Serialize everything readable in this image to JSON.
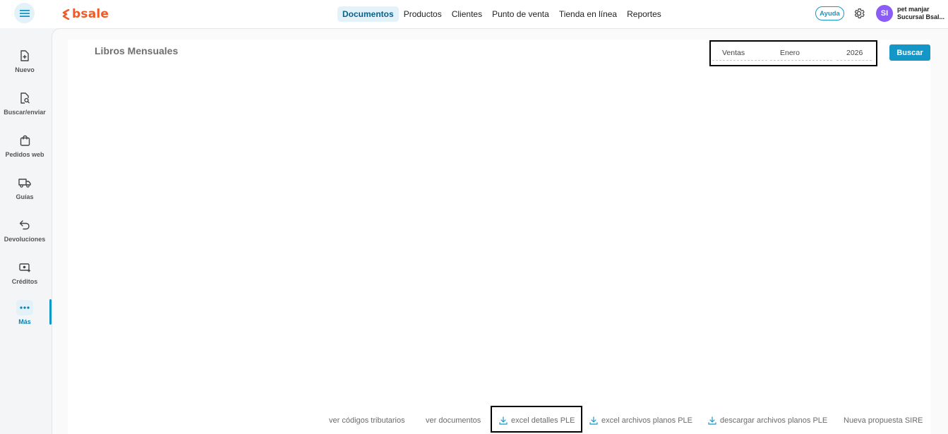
{
  "header": {
    "logo_text": "bsale",
    "nav": [
      "Documentos",
      "Productos",
      "Clientes",
      "Punto de venta",
      "Tienda en línea",
      "Reportes"
    ],
    "active_nav": "Documentos",
    "help_label": "Ayuda",
    "avatar_initials": "SI",
    "user_name": "pet manjar",
    "user_branch": "Sucursal Bsal..."
  },
  "sidebar": {
    "items": [
      {
        "label": "Nuevo",
        "icon": "file-plus-icon"
      },
      {
        "label": "Buscar/enviar",
        "icon": "file-search-icon"
      },
      {
        "label": "Pedidos web",
        "icon": "shopping-bag-icon"
      },
      {
        "label": "Guías",
        "icon": "truck-icon"
      },
      {
        "label": "Devoluciones",
        "icon": "return-arrow-icon"
      },
      {
        "label": "Créditos",
        "icon": "credit-icon"
      },
      {
        "label": "Más",
        "icon": "more-dots-icon"
      }
    ],
    "active": "Más"
  },
  "page": {
    "title": "Libros Mensuales",
    "filters": {
      "tipo": "Ventas",
      "mes": "Enero",
      "anio": "2026"
    },
    "search_button": "Buscar"
  },
  "footer": {
    "links": [
      {
        "label": "ver códigos tributarios",
        "icon": ""
      },
      {
        "label": "ver documentos",
        "icon": ""
      },
      {
        "label": "excel detalles PLE",
        "icon": "download-icon"
      },
      {
        "label": "excel archivos planos PLE",
        "icon": "download-icon"
      },
      {
        "label": "descargar archivos planos PLE",
        "icon": "download-icon"
      },
      {
        "label": "Nueva propuesta SIRE",
        "icon": ""
      }
    ]
  },
  "colors": {
    "accent": "#1497c7",
    "brand": "#f05a28",
    "avatar": "#8b5cf6"
  }
}
